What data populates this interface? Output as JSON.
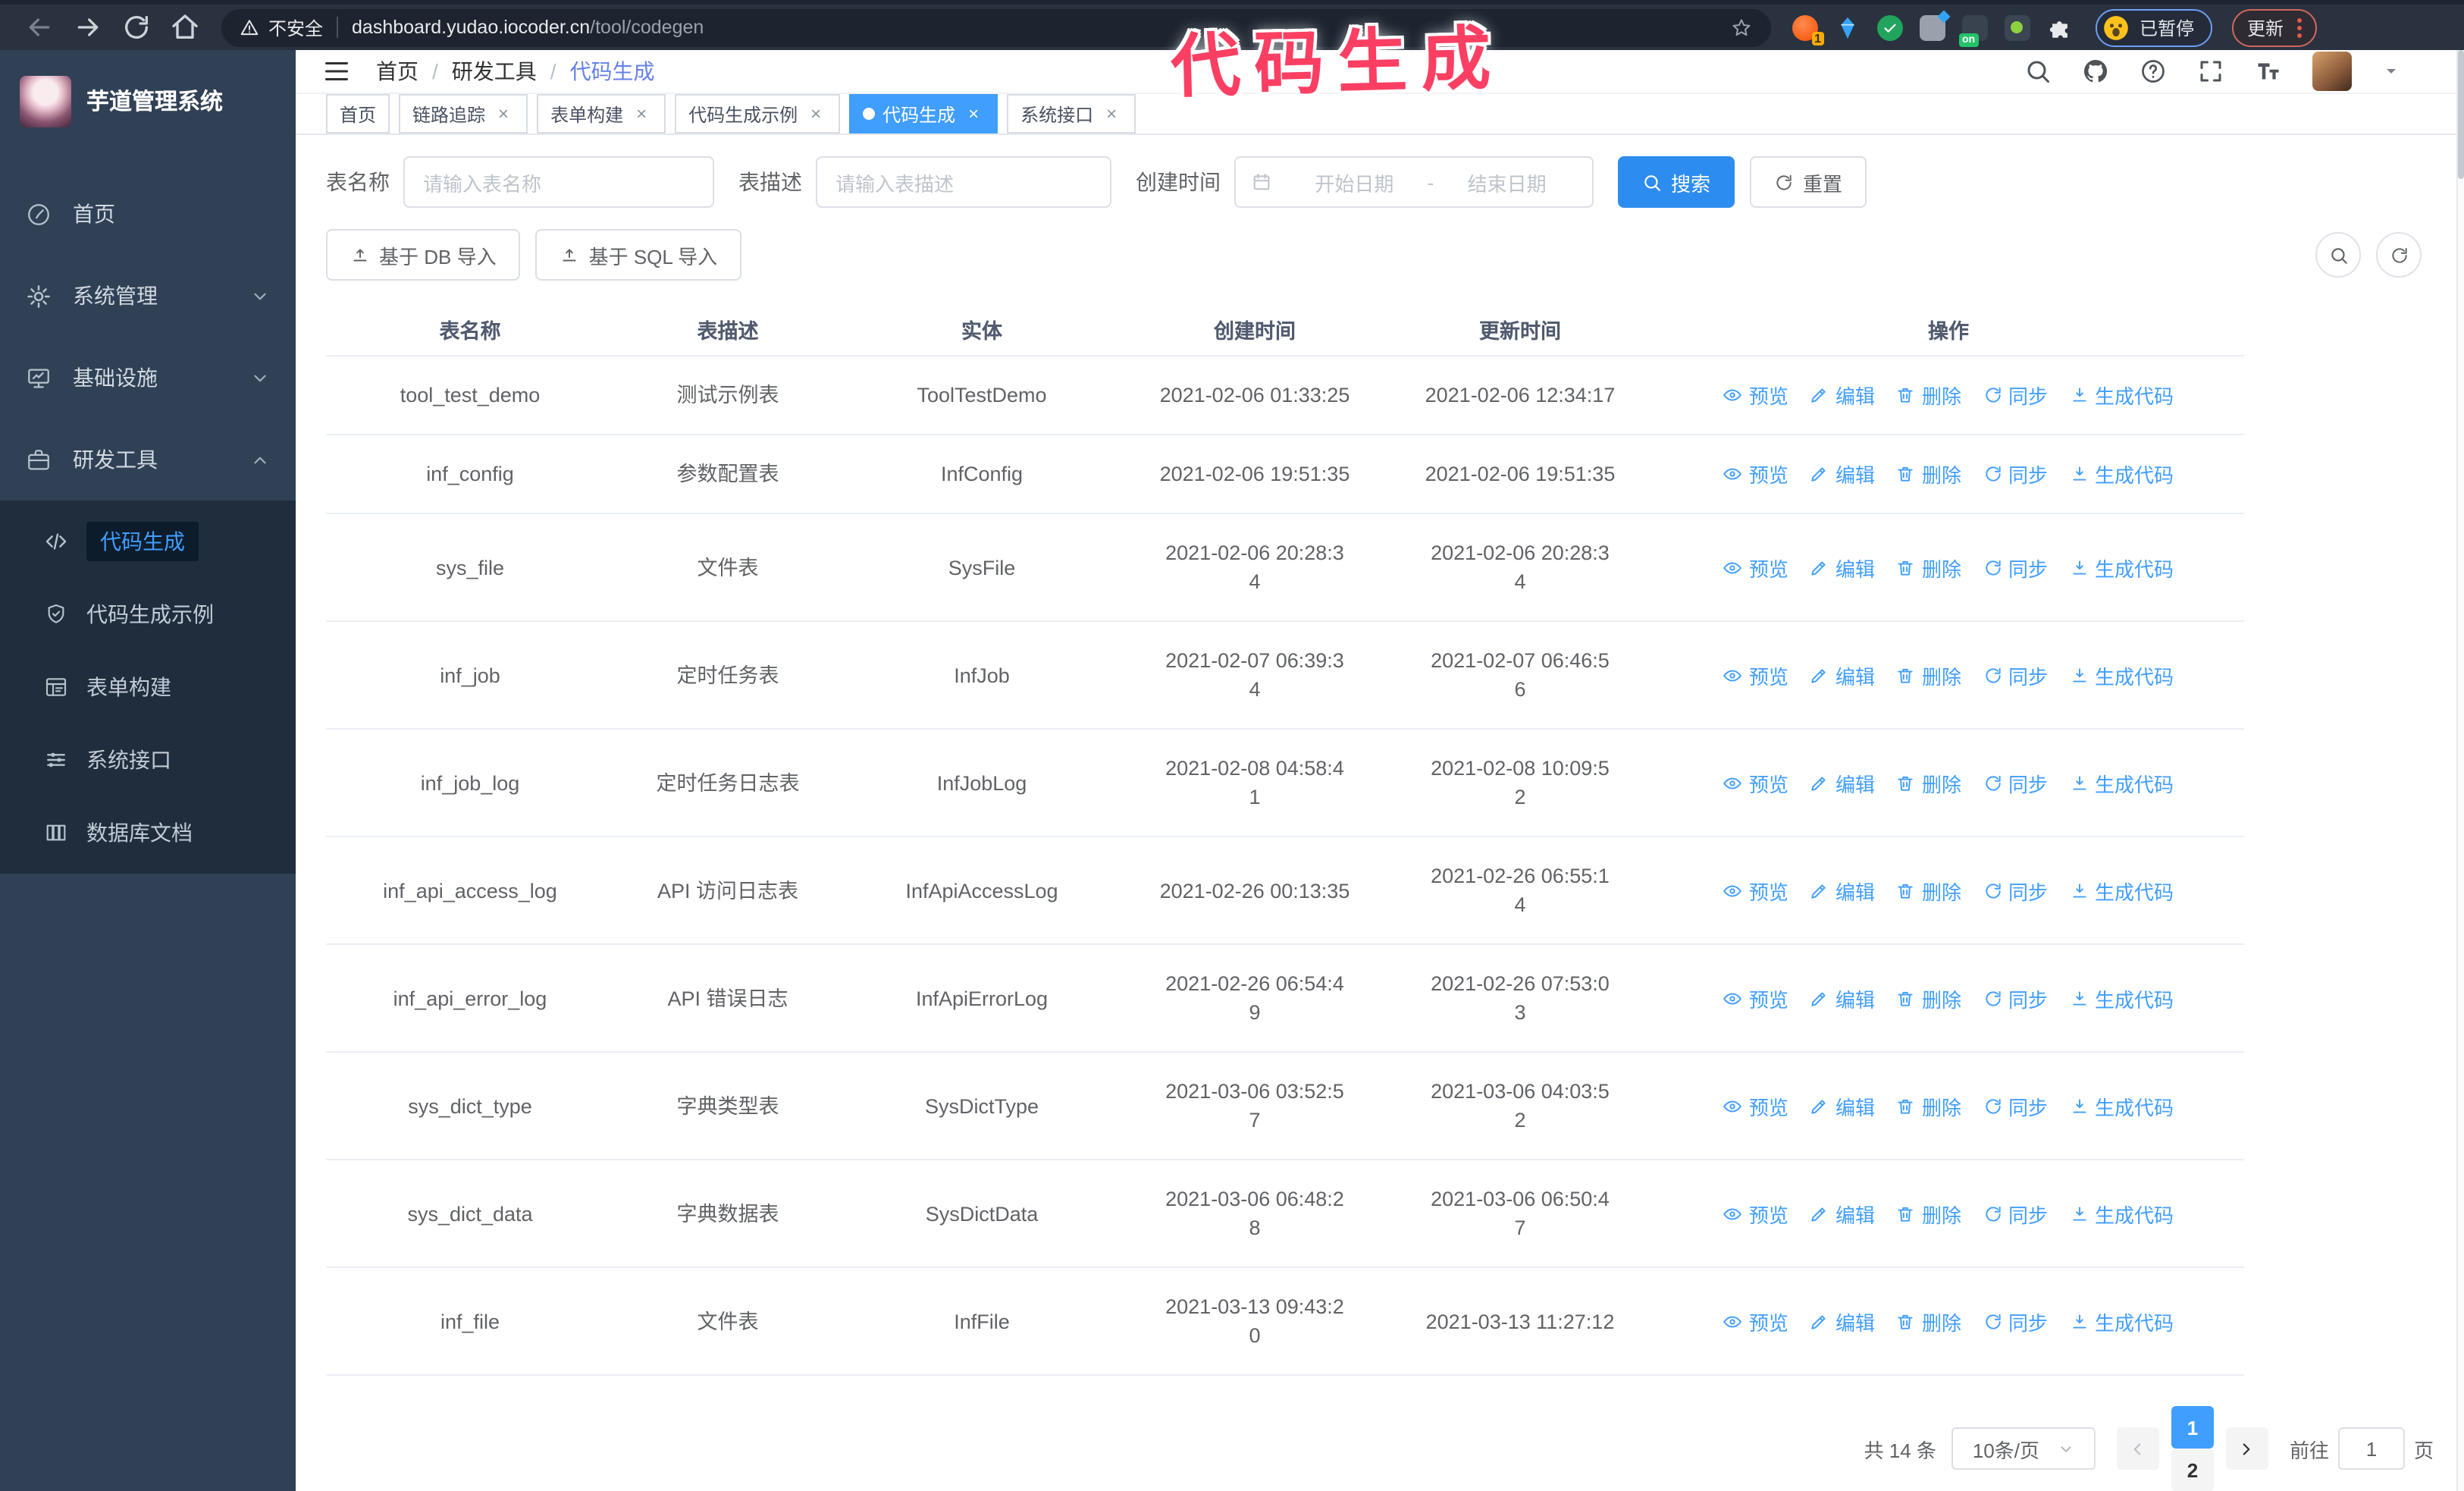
{
  "browser": {
    "security_label": "不安全",
    "url_host": "dashboard.yudao.iocoder.cn",
    "url_path": "/tool/codegen",
    "ext1_badge": "1",
    "ext_on_badge": "on",
    "profile_badge": "已暂停",
    "update_button": "更新"
  },
  "watermark": "代码生成",
  "header": {
    "breadcrumb": [
      "首页",
      "研发工具",
      "代码生成"
    ]
  },
  "tabs": [
    {
      "id": "home",
      "label": "首页",
      "active": false,
      "closable": false
    },
    {
      "id": "tracer",
      "label": "链路追踪",
      "active": false,
      "closable": true
    },
    {
      "id": "form-build",
      "label": "表单构建",
      "active": false,
      "closable": true
    },
    {
      "id": "codegen-example",
      "label": "代码生成示例",
      "active": false,
      "closable": true
    },
    {
      "id": "codegen",
      "label": "代码生成",
      "active": true,
      "closable": true
    },
    {
      "id": "system-api",
      "label": "系统接口",
      "active": false,
      "closable": true
    }
  ],
  "sidebar": {
    "title": "芋道管理系统",
    "menu": [
      {
        "id": "home",
        "label": "首页",
        "icon": "dashboard-icon",
        "expandable": false,
        "expanded": false
      },
      {
        "id": "system",
        "label": "系统管理",
        "icon": "gear-icon",
        "expandable": true,
        "expanded": false
      },
      {
        "id": "infra",
        "label": "基础设施",
        "icon": "monitor-icon",
        "expandable": true,
        "expanded": false
      },
      {
        "id": "devtools",
        "label": "研发工具",
        "icon": "briefcase-icon",
        "expandable": true,
        "expanded": true
      }
    ],
    "submenu": [
      {
        "id": "codegen",
        "label": "代码生成",
        "icon": "code-icon",
        "active": true
      },
      {
        "id": "codegen-example",
        "label": "代码生成示例",
        "icon": "shield-icon",
        "active": false
      },
      {
        "id": "form-build",
        "label": "表单构建",
        "icon": "form-icon",
        "active": false
      },
      {
        "id": "system-api",
        "label": "系统接口",
        "icon": "sliders-icon",
        "active": false
      },
      {
        "id": "db-doc",
        "label": "数据库文档",
        "icon": "database-icon",
        "active": false
      }
    ]
  },
  "search": {
    "fields": [
      {
        "label": "表名称",
        "placeholder": "请输入表名称"
      },
      {
        "label": "表描述",
        "placeholder": "请输入表描述"
      }
    ],
    "date_label": "创建时间",
    "date_start_placeholder": "开始日期",
    "date_separator": "-",
    "date_end_placeholder": "结束日期",
    "search_button": "搜索",
    "reset_button": "重置"
  },
  "toolbar": {
    "import_db": "基于 DB 导入",
    "import_sql": "基于 SQL 导入"
  },
  "table": {
    "columns": [
      "表名称",
      "表描述",
      "实体",
      "创建时间",
      "更新时间",
      "操作"
    ],
    "actions": [
      "预览",
      "编辑",
      "删除",
      "同步",
      "生成代码"
    ],
    "action_ids": [
      "preview",
      "edit",
      "delete",
      "sync",
      "generate"
    ],
    "action_icons": [
      "eye-icon",
      "edit-icon",
      "delete-icon",
      "sync-icon",
      "download-icon"
    ],
    "rows": [
      {
        "name": "tool_test_demo",
        "desc": "测试示例表",
        "entity": "ToolTestDemo",
        "created": [
          "2021-02-06 01:33:25"
        ],
        "updated": [
          "2021-02-06 12:34:17"
        ]
      },
      {
        "name": "inf_config",
        "desc": "参数配置表",
        "entity": "InfConfig",
        "created": [
          "2021-02-06 19:51:35"
        ],
        "updated": [
          "2021-02-06 19:51:35"
        ]
      },
      {
        "name": "sys_file",
        "desc": "文件表",
        "entity": "SysFile",
        "created": [
          "2021-02-06 20:28:3",
          "4"
        ],
        "updated": [
          "2021-02-06 20:28:3",
          "4"
        ]
      },
      {
        "name": "inf_job",
        "desc": "定时任务表",
        "entity": "InfJob",
        "created": [
          "2021-02-07 06:39:3",
          "4"
        ],
        "updated": [
          "2021-02-07 06:46:5",
          "6"
        ]
      },
      {
        "name": "inf_job_log",
        "desc": "定时任务日志表",
        "entity": "InfJobLog",
        "created": [
          "2021-02-08 04:58:4",
          "1"
        ],
        "updated": [
          "2021-02-08 10:09:5",
          "2"
        ]
      },
      {
        "name": "inf_api_access_log",
        "desc": "API 访问日志表",
        "entity": "InfApiAccessLog",
        "created": [
          "2021-02-26 00:13:35"
        ],
        "updated": [
          "2021-02-26 06:55:1",
          "4"
        ]
      },
      {
        "name": "inf_api_error_log",
        "desc": "API 错误日志",
        "entity": "InfApiErrorLog",
        "created": [
          "2021-02-26 06:54:4",
          "9"
        ],
        "updated": [
          "2021-02-26 07:53:0",
          "3"
        ]
      },
      {
        "name": "sys_dict_type",
        "desc": "字典类型表",
        "entity": "SysDictType",
        "created": [
          "2021-03-06 03:52:5",
          "7"
        ],
        "updated": [
          "2021-03-06 04:03:5",
          "2"
        ]
      },
      {
        "name": "sys_dict_data",
        "desc": "字典数据表",
        "entity": "SysDictData",
        "created": [
          "2021-03-06 06:48:2",
          "8"
        ],
        "updated": [
          "2021-03-06 06:50:4",
          "7"
        ]
      },
      {
        "name": "inf_file",
        "desc": "文件表",
        "entity": "InfFile",
        "created": [
          "2021-03-13 09:43:2",
          "0"
        ],
        "updated": [
          "2021-03-13 11:27:12"
        ]
      }
    ]
  },
  "pagination": {
    "total_text": "共 14 条",
    "page_size": "10条/页",
    "pages": [
      "1",
      "2"
    ],
    "active_page": "1",
    "goto_label": "前往",
    "goto_value": "1",
    "goto_suffix": "页"
  },
  "colors": {
    "primary": "#409EFF",
    "sidebar_bg": "#304156",
    "submenu_bg": "#1F2D3D",
    "active_tab": "#409EFF",
    "watermark": "#FB3F63",
    "browser_bar": "#2A3240"
  }
}
